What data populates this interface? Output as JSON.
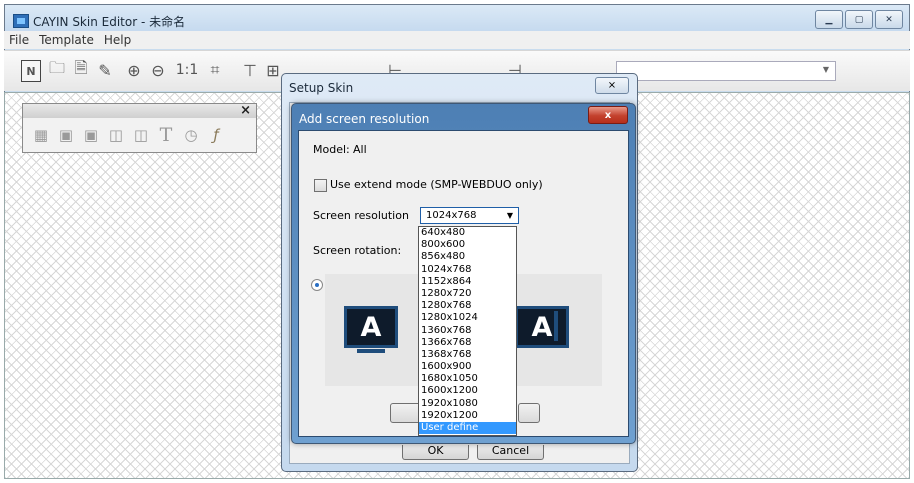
{
  "window": {
    "title": "CAYIN Skin Editor - 未命名"
  },
  "menu": {
    "items": [
      "File",
      "Template",
      "Help"
    ]
  },
  "toolbar": {
    "new_label": "N",
    "actual_size_label": "1:1"
  },
  "palette": {
    "close_label": "×",
    "text_tool_label": "T",
    "tools": [
      "image-icon",
      "video-icon-1",
      "video-icon-2",
      "layer-icon-1",
      "layer-icon-2",
      "text-icon",
      "clock-icon",
      "flash-icon"
    ]
  },
  "setup_skin": {
    "title": "Setup Skin",
    "close_label": "⨯",
    "ok_label": "OK",
    "cancel_label": "Cancel"
  },
  "add_resolution": {
    "title": "Add screen resolution",
    "close_label": "x",
    "model_label": "Model:",
    "model_value": "All",
    "extend_mode_label": "Use extend mode (SMP-WEBDUO only)",
    "resolution_label": "Screen resolution",
    "selected_resolution": "1024x768",
    "rotation_label": "Screen rotation:",
    "monitor_letter": "A",
    "options": [
      "640x480",
      "800x600",
      "856x480",
      "1024x768",
      "1152x864",
      "1280x720",
      "1280x768",
      "1280x1024",
      "1360x768",
      "1366x768",
      "1368x768",
      "1600x900",
      "1680x1050",
      "1600x1200",
      "1920x1080",
      "1920x1200",
      "User define"
    ],
    "highlighted_option": "User define"
  }
}
